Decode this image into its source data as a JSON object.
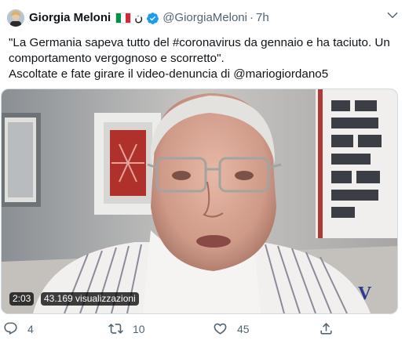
{
  "author": {
    "name": "Giorgia Meloni",
    "arabic_mark": "ن",
    "handle": "@GiorgiaMeloni",
    "separator": "·",
    "time": "7h"
  },
  "tweet": {
    "line1_before": "\"La Germania sapeva tutto del ",
    "hashtag": "#coronavirus",
    "line1_after": " da gennaio e ha taciuto. Un comportamento vergognoso e scorretto\".",
    "line2_before": "Ascoltate e fate girare il video-denuncia di ",
    "mention": "@mariogiordano5"
  },
  "video": {
    "duration": "2:03",
    "views": "43.169 visualizzazioni",
    "watermark": "V"
  },
  "actions": {
    "reply_count": "4",
    "retweet_count": "10",
    "like_count": "45"
  },
  "colors": {
    "accent": "#1d9bf0",
    "muted": "#536471",
    "flag_green": "#009246",
    "flag_white": "#ffffff",
    "flag_red": "#ce2b37"
  }
}
